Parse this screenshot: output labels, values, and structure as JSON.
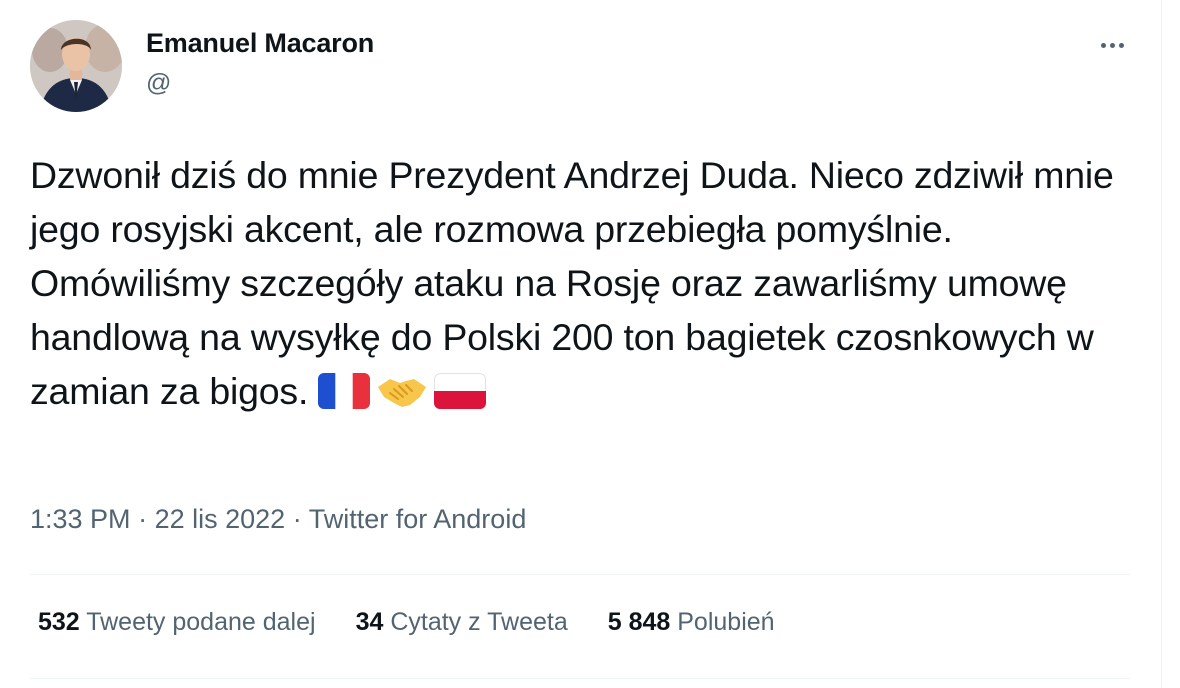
{
  "user": {
    "name": "Emanuel Macaron",
    "handle": "@"
  },
  "tweet": {
    "text": "Dzwonił dziś do mnie Prezydent Andrzej Duda. Nieco zdziwił mnie jego rosyjski akcent, ale rozmowa przebiegła pomyślnie. Omówiliśmy szczegóły ataku na Rosję oraz zawarliśmy umowę handlową na wysyłkę do Polski 200 ton bagietek czosnkowych w zamian za bigos.",
    "emojis": [
      "flag-france-icon",
      "handshake-icon",
      "flag-poland-icon"
    ],
    "time": "1:33 PM",
    "separator": "·",
    "date": "22 lis 2022",
    "source": "Twitter for Android"
  },
  "stats": {
    "retweets_count": "532",
    "retweets_label": "Tweety podane dalej",
    "quotes_count": "34",
    "quotes_label": "Cytaty z Tweeta",
    "likes_count": "5 848",
    "likes_label": "Polubień"
  },
  "colors": {
    "text": "#0f1419",
    "secondary": "#536471",
    "divider": "#eff3f4",
    "france_blue": "#1f4fd1",
    "france_red": "#e8313d",
    "poland_red": "#dc143c",
    "handshake": "#f7c64b"
  }
}
